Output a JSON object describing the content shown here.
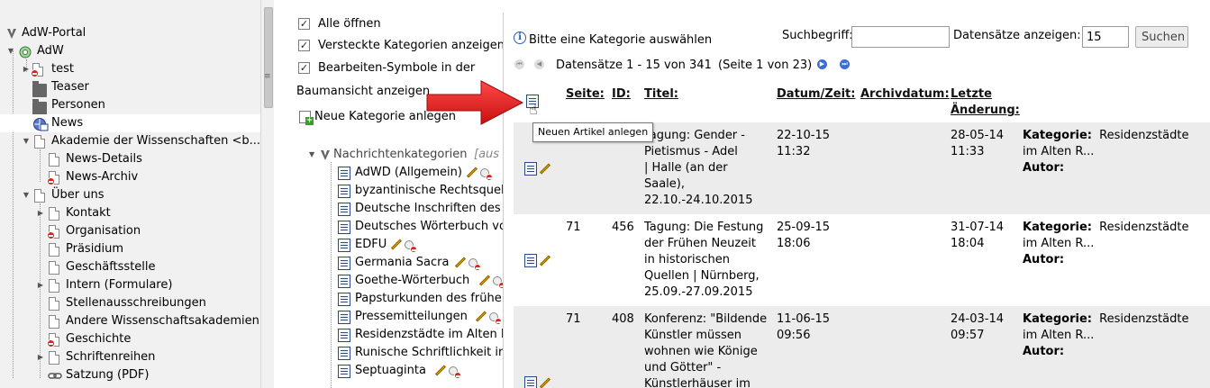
{
  "tree": {
    "items": [
      {
        "label": "AdW-Portal"
      },
      {
        "label": "AdW"
      },
      {
        "label": "test"
      },
      {
        "label": "Teaser"
      },
      {
        "label": "Personen"
      },
      {
        "label": "News"
      },
      {
        "label": "Akademie der Wissenschaften <b..."
      },
      {
        "label": "News-Details"
      },
      {
        "label": "News-Archiv"
      },
      {
        "label": "Über uns"
      },
      {
        "label": "Kontakt"
      },
      {
        "label": "Organisation"
      },
      {
        "label": "Präsidium"
      },
      {
        "label": "Geschäftsstelle"
      },
      {
        "label": "Intern (Formulare)"
      },
      {
        "label": "Stellenausschreibungen"
      },
      {
        "label": "Andere Wissenschaftsakademien"
      },
      {
        "label": "Geschichte"
      },
      {
        "label": "Schriftenreihen"
      },
      {
        "label": "Satzung (PDF)"
      }
    ]
  },
  "options": {
    "open_all": "Alle öffnen",
    "show_hidden": "Versteckte Kategorien anzeigen",
    "edit_symbols_line1": "Bearbeiten-Symbole in der",
    "edit_symbols_line2": "Baumansicht anzeigen",
    "new_category": "Neue Kategorie anlegen"
  },
  "categories": {
    "root": "Nachrichtenkategorien",
    "root_suffix": "[aus a",
    "items": [
      "AdWD (Allgemein)",
      "byzantinische Rechtsquelle",
      "Deutsche Inschriften des M",
      "Deutsches Wörterbuch vo",
      "EDFU",
      "Germania Sacra",
      "Goethe-Wörterbuch",
      "Papsturkunden des frühe",
      "Pressemitteilungen",
      "Residenzstädte im Alten R",
      "Runische Schriftlichkeit in d",
      "Septuaginta"
    ]
  },
  "list": {
    "hint": "Bitte eine Kategorie auswählen",
    "search_label": "Suchbegriff:",
    "search_value": "",
    "per_page_label": "Datensätze anzeigen:",
    "per_page_value": "15",
    "search_button": "Suchen",
    "records": "Datensätze 1 - 15 von 341",
    "page_info": "(Seite 1 von 23)",
    "headers": {
      "page": "Seite:",
      "id": "ID:",
      "title": "Titel:",
      "datetime": "Datum/Zeit:",
      "archive": "Archivdatum:",
      "changed_1": "Letzte",
      "changed_2": "Änderung:"
    },
    "meta_category_label": "Kategorie:",
    "meta_author_label": "Autor:",
    "rows": [
      {
        "page": "",
        "id": "",
        "title_lines": [
          "Tagung: Gender -",
          "Pietismus - Adel",
          "| Halle (an der",
          "Saale),",
          "22.10.-24.10.2015"
        ],
        "date": "22-10-15",
        "time": "11:32",
        "archive": "",
        "changed_date": "28-05-14",
        "changed_time": "11:33",
        "category": "Residenzstädte",
        "category2": "im Alten R..."
      },
      {
        "page": "71",
        "id": "456",
        "title_lines": [
          "Tagung: Die Festung",
          "der Frühen Neuzeit",
          "in historischen",
          "Quellen | Nürnberg,",
          "25.09.-27.09.2015"
        ],
        "date": "25-09-15",
        "time": "18:06",
        "archive": "",
        "changed_date": "31-07-14",
        "changed_time": "18:04",
        "category": "Residenzstädte",
        "category2": "im Alten R..."
      },
      {
        "page": "71",
        "id": "408",
        "title_lines": [
          "Konferenz: \"Bildende",
          "Künstler müssen",
          "wohnen wie Könige",
          "und Götter\" -",
          "Künstlerhäuser im"
        ],
        "date": "11-06-15",
        "time": "09:56",
        "archive": "",
        "changed_date": "24-03-14",
        "changed_time": "09:57",
        "category": "Residenzstädte",
        "category2": "im Alten R..."
      }
    ],
    "tooltip": "Neuen Artikel anlegen"
  },
  "colors": {
    "arrow": "#e41e1e",
    "link": "#1a3d8f",
    "tree_bg": "#f1f1f1",
    "row_alt": "#ececec"
  }
}
